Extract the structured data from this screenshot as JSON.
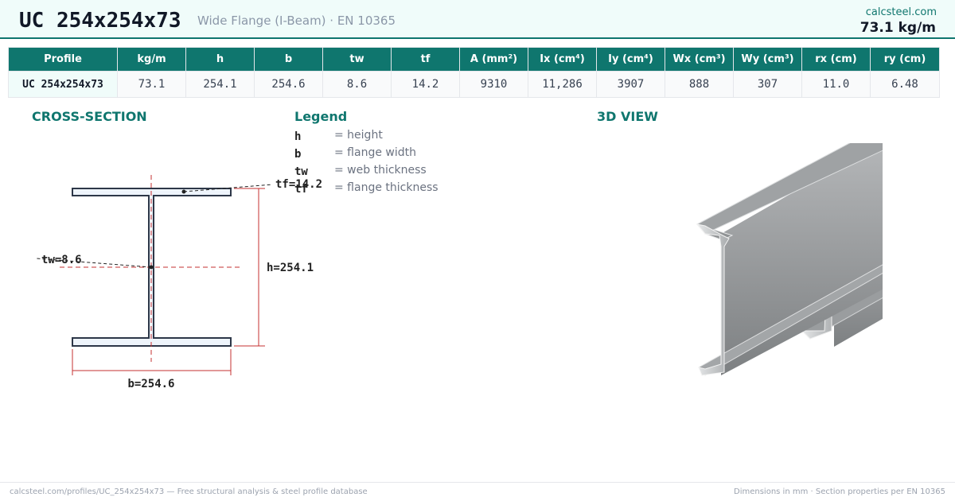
{
  "header": {
    "profile": "UC 254x254x73",
    "subtitle": "Wide Flange (I-Beam)  ·  EN 10365",
    "site": "calcsteel.com",
    "weight": "73.1 kg/m"
  },
  "table": {
    "headers": [
      "Profile",
      "kg/m",
      "h",
      "b",
      "tw",
      "tf",
      "A (mm²)",
      "Ix (cm⁴)",
      "Iy (cm⁴)",
      "Wx (cm³)",
      "Wy (cm³)",
      "rx (cm)",
      "ry (cm)"
    ],
    "row": [
      "UC 254x254x73",
      "73.1",
      "254.1",
      "254.6",
      "8.6",
      "14.2",
      "9310",
      "11,286",
      "3907",
      "888",
      "307",
      "11.0",
      "6.48"
    ]
  },
  "cross_section": {
    "title": "CROSS-SECTION",
    "tf_label": "tf=14.2",
    "tw_label": "tw=8.6",
    "h_label": "h=254.1",
    "b_label": "b=254.6"
  },
  "legend": {
    "title": "Legend",
    "items": [
      {
        "key": "h",
        "desc": "= height"
      },
      {
        "key": "b",
        "desc": "= flange width"
      },
      {
        "key": "tw",
        "desc": "= web thickness"
      },
      {
        "key": "tf",
        "desc": "= flange thickness"
      }
    ]
  },
  "view3d": {
    "title": "3D VIEW"
  },
  "footer": {
    "left": "calcsteel.com/profiles/UC_254x254x73 — Free structural analysis & steel profile database",
    "right": "Dimensions in mm · Section properties per EN 10365"
  },
  "colors": {
    "accent": "#0f766e",
    "header_bg": "#f0fcfa",
    "dimension": "#b91c1c",
    "steel": "#9ca3af"
  }
}
